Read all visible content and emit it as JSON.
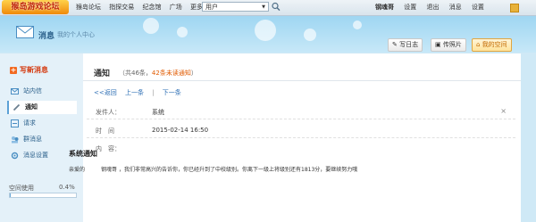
{
  "topbar": {
    "logo_text": "猴岛游戏论坛",
    "nav": [
      "猴岛论坛",
      "指探交易",
      "纪念馆",
      "广场",
      "更多"
    ],
    "user_select": "用户",
    "right_nav": [
      "钢魂哥",
      "设置",
      "退出",
      "消息",
      "设置"
    ]
  },
  "header": {
    "title": "消息",
    "subtitle": "我的个人中心",
    "buttons": [
      "写日志",
      "传照片",
      "我的空间"
    ]
  },
  "sidebar": {
    "write": "写新消息",
    "items": [
      "站内信",
      "通知",
      "请求",
      "群消息",
      "消息设置"
    ],
    "space_label": "空间使用",
    "space_pct": "0.4%",
    "space_used": 0.004
  },
  "content": {
    "title": "通知",
    "count_prefix": "（共46条，",
    "count_unread": "42条未读通知",
    "count_suffix": "）",
    "pager": [
      "<<返回",
      "上一条",
      "|",
      "下一条"
    ],
    "rows": {
      "sender_label": "发件人：",
      "sender_value": "系统",
      "time_label": "时　间",
      "time_value": "2015-02-14 16:50",
      "body_label": "内　容："
    },
    "msg_title": "系统通知",
    "msg_greeting": "亲爱的",
    "msg_name": "钢魂哥",
    "msg_body": "，我们非常高兴的告诉你，你已经升到了中校级别。你离下一级上将级别还有1813分，要继续努力哦"
  },
  "colors": {
    "accent": "#2a6cb3",
    "unread": "#e05a00",
    "sky": "#9fd6f2"
  }
}
